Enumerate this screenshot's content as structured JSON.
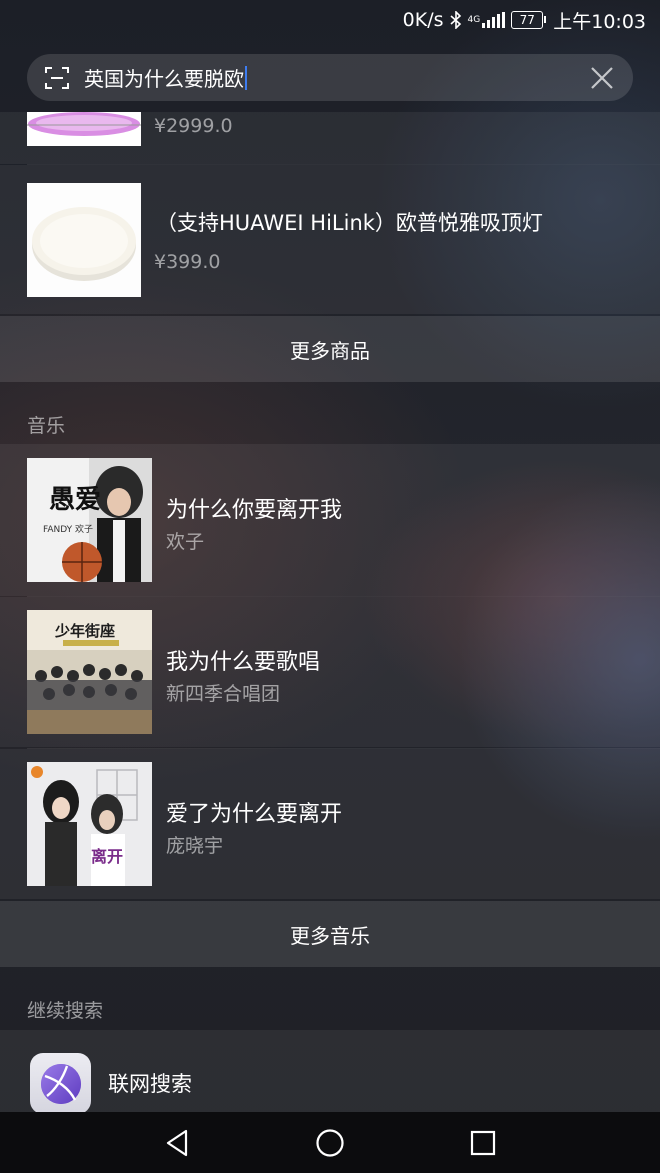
{
  "status_bar": {
    "net_speed": "0K/s",
    "bluetooth_icon": "bluetooth-icon",
    "network_type": "4G",
    "battery_level": "77",
    "time": "上午10:03"
  },
  "search": {
    "query": "英国为什么要脱欧",
    "scan_icon": "scan-icon",
    "clear_icon": "close-icon"
  },
  "products": {
    "items": [
      {
        "title": "",
        "price": "¥2999.0",
        "image": "ceiling-lamp-purple-ring"
      },
      {
        "title": "（支持HUAWEI HiLink）欧普悦雅吸顶灯",
        "price": "¥399.0",
        "image": "ceiling-lamp-white-round"
      }
    ],
    "more_label": "更多商品"
  },
  "music": {
    "header": "音乐",
    "songs": [
      {
        "title": "为什么你要离开我",
        "artist": "欢子",
        "cover": "album-cover-愚爱",
        "cover_text": "愚爱",
        "cover_sub": "FANDY 欢子"
      },
      {
        "title": "我为什么要歌唱",
        "artist": "新四季合唱团",
        "cover": "album-cover-少年街座",
        "cover_text": "少年街座"
      },
      {
        "title": "爱了为什么要离开",
        "artist": "庞晓宇",
        "cover": "album-cover-离开",
        "cover_text": "离开"
      }
    ],
    "more_label": "更多音乐"
  },
  "continue_search": {
    "header": "继续搜索",
    "web_search_label": "联网搜索",
    "web_search_icon": "globe-search-icon"
  },
  "nav": {
    "back_icon": "back-triangle-icon",
    "home_icon": "home-circle-icon",
    "recents_icon": "recents-square-icon"
  },
  "colors": {
    "caret": "#3d7cf0",
    "secondary_text": "#8c8c93",
    "app_icon_purple": "#7b57d6"
  }
}
